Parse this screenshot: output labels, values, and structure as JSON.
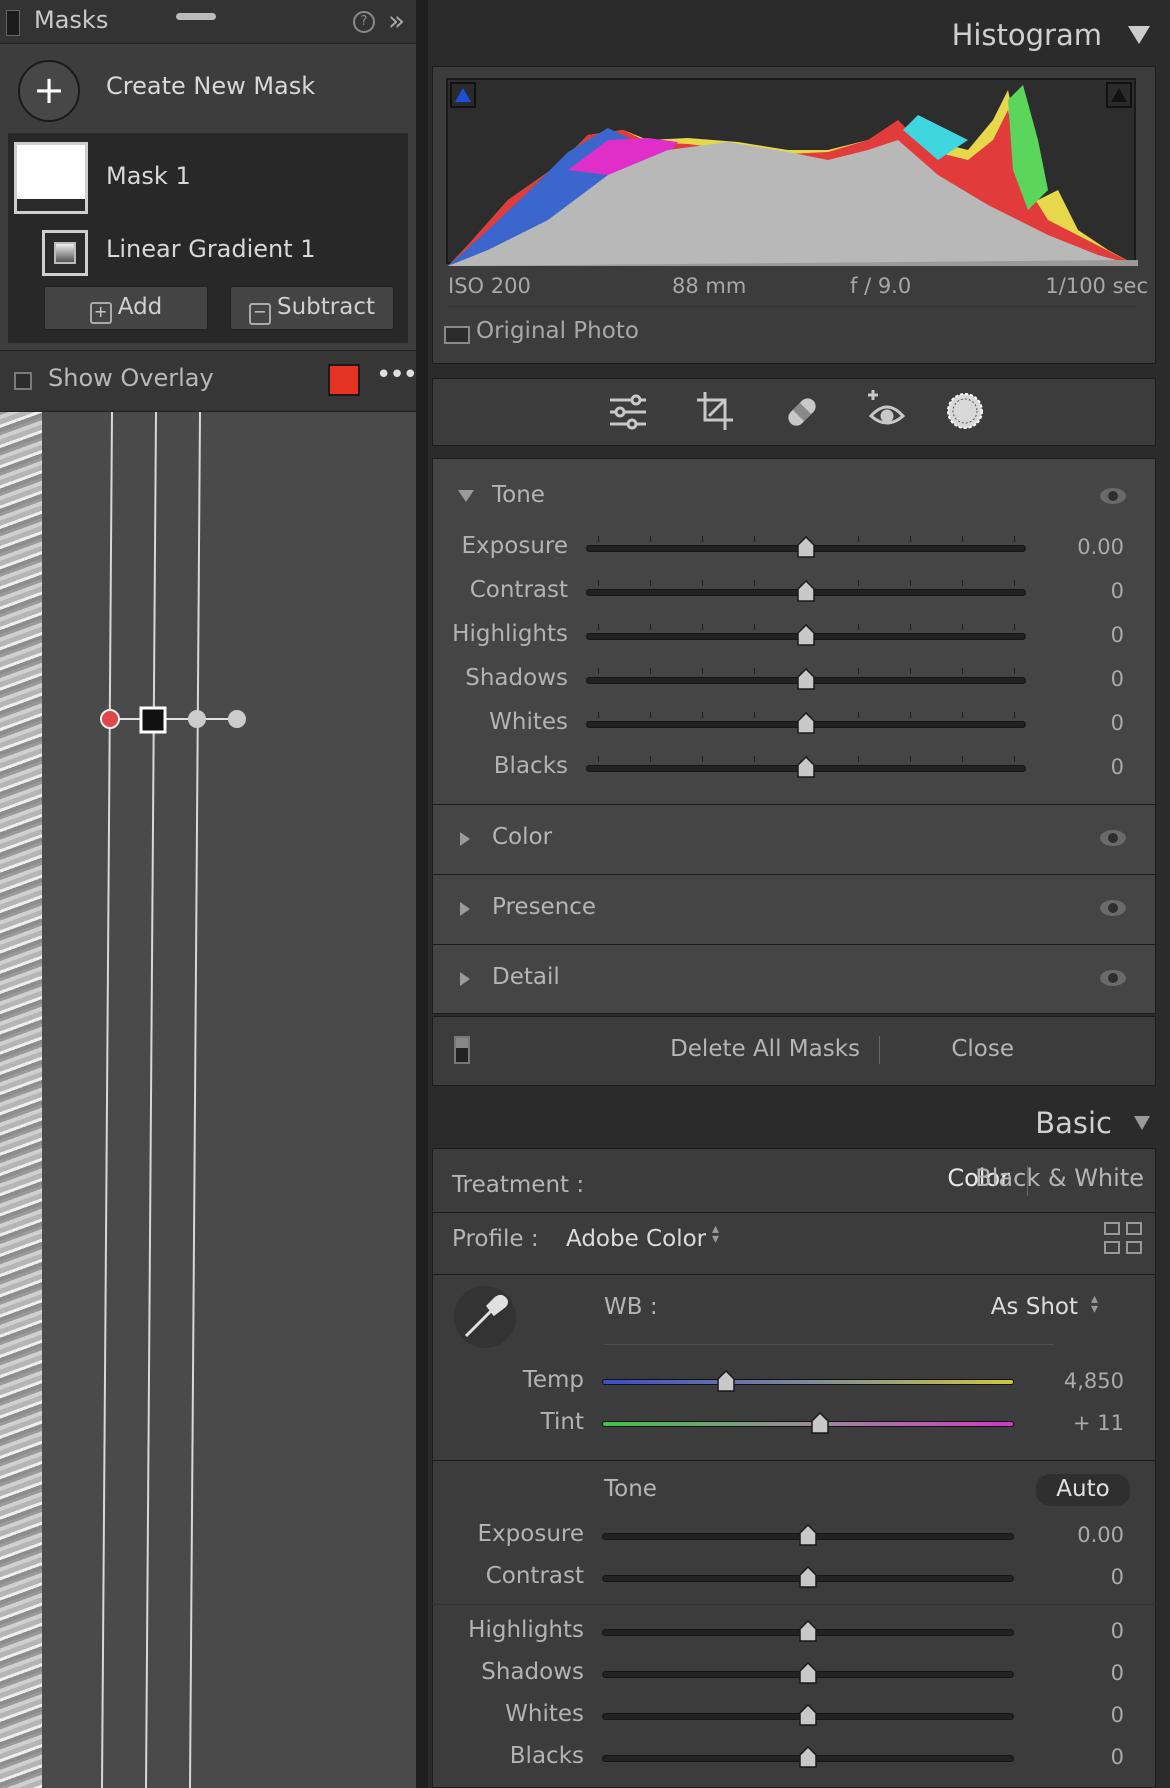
{
  "masks_panel": {
    "title": "Masks",
    "help_label": "?",
    "collapse_label": "»",
    "create_new_label": "Create New Mask",
    "plus_label": "+",
    "mask_name": "Mask 1",
    "component_name": "Linear Gradient 1",
    "add_label": "Add",
    "subtract_label": "Subtract",
    "show_overlay_label": "Show Overlay",
    "overlay_color": "#e53323",
    "more_label": "•••"
  },
  "histogram": {
    "title": "Histogram",
    "iso": "ISO 200",
    "focal_length": "88 mm",
    "aperture": "f / 9.0",
    "shutter": "1/100 sec",
    "original_photo_label": "Original Photo"
  },
  "tools": [
    "adjust-sliders",
    "crop",
    "healing",
    "red-eye",
    "masking"
  ],
  "mask_sections": {
    "tone": {
      "title": "Tone",
      "sliders": [
        {
          "label": "Exposure",
          "value": "0.00",
          "position": 0.5
        },
        {
          "label": "Contrast",
          "value": "0",
          "position": 0.5
        },
        {
          "label": "Highlights",
          "value": "0",
          "position": 0.5
        },
        {
          "label": "Shadows",
          "value": "0",
          "position": 0.5
        },
        {
          "label": "Whites",
          "value": "0",
          "position": 0.5
        },
        {
          "label": "Blacks",
          "value": "0",
          "position": 0.5
        }
      ]
    },
    "collapsed": [
      "Color",
      "Presence",
      "Detail"
    ],
    "delete_all_label": "Delete All Masks",
    "close_label": "Close"
  },
  "basic": {
    "title": "Basic",
    "treatment_label": "Treatment :",
    "treatment_color": "Color",
    "treatment_bw": "Black & White",
    "profile_label": "Profile :",
    "profile_value": "Adobe Color",
    "wb_label": "WB :",
    "wb_value": "As Shot",
    "temp": {
      "label": "Temp",
      "value": "4,850",
      "position": 0.3
    },
    "tint": {
      "label": "Tint",
      "value": "+ 11",
      "position": 0.53
    },
    "tone_label": "Tone",
    "auto_label": "Auto",
    "sliders": [
      {
        "label": "Exposure",
        "value": "0.00",
        "position": 0.5
      },
      {
        "label": "Contrast",
        "value": "0",
        "position": 0.5
      },
      {
        "label": "Highlights",
        "value": "0",
        "position": 0.5
      },
      {
        "label": "Shadows",
        "value": "0",
        "position": 0.5
      },
      {
        "label": "Whites",
        "value": "0",
        "position": 0.5
      },
      {
        "label": "Blacks",
        "value": "0",
        "position": 0.5
      }
    ]
  }
}
